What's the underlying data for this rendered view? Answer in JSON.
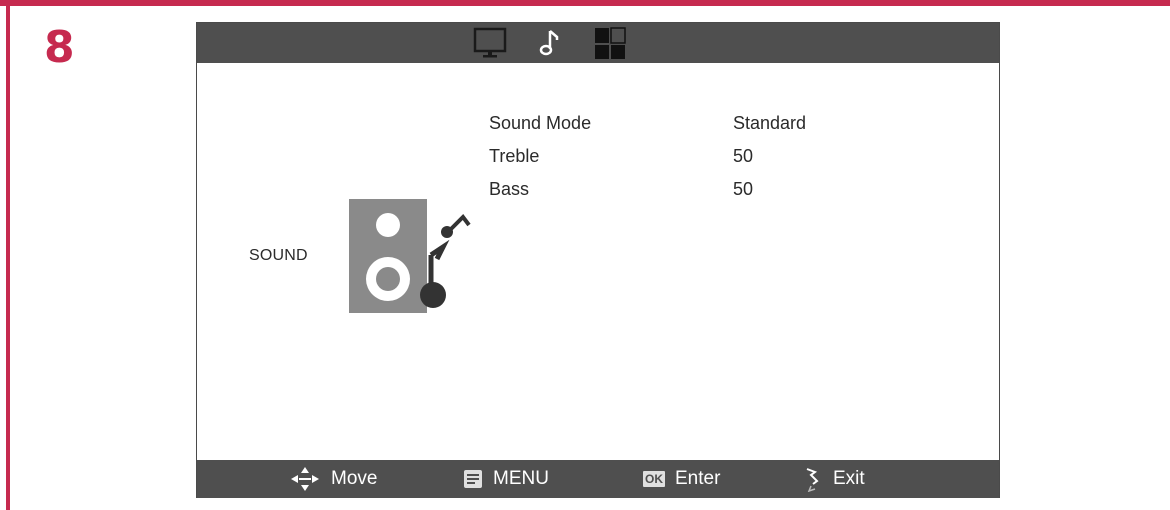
{
  "step_number": "8",
  "tabs": [
    {
      "icon": "monitor-icon"
    },
    {
      "icon": "music-note-icon"
    },
    {
      "icon": "grid-icon"
    }
  ],
  "section": {
    "label": "SOUND",
    "icon": "speaker-music-icon"
  },
  "settings": [
    {
      "label": "Sound Mode",
      "value": "Standard"
    },
    {
      "label": "Treble",
      "value": "50"
    },
    {
      "label": "Bass",
      "value": "50"
    }
  ],
  "footer": {
    "move": {
      "icon": "move-arrows-icon",
      "label": "Move"
    },
    "menu": {
      "icon": "menu-icon",
      "label": "MENU"
    },
    "enter": {
      "icon": "ok-icon",
      "badge": "OK",
      "label": "Enter"
    },
    "exit": {
      "icon": "exit-icon",
      "label": "Exit"
    }
  },
  "colors": {
    "frame_accent": "#c62a4f",
    "bar_background": "#4f4f4f",
    "speaker_gray": "#8a8a8a"
  }
}
